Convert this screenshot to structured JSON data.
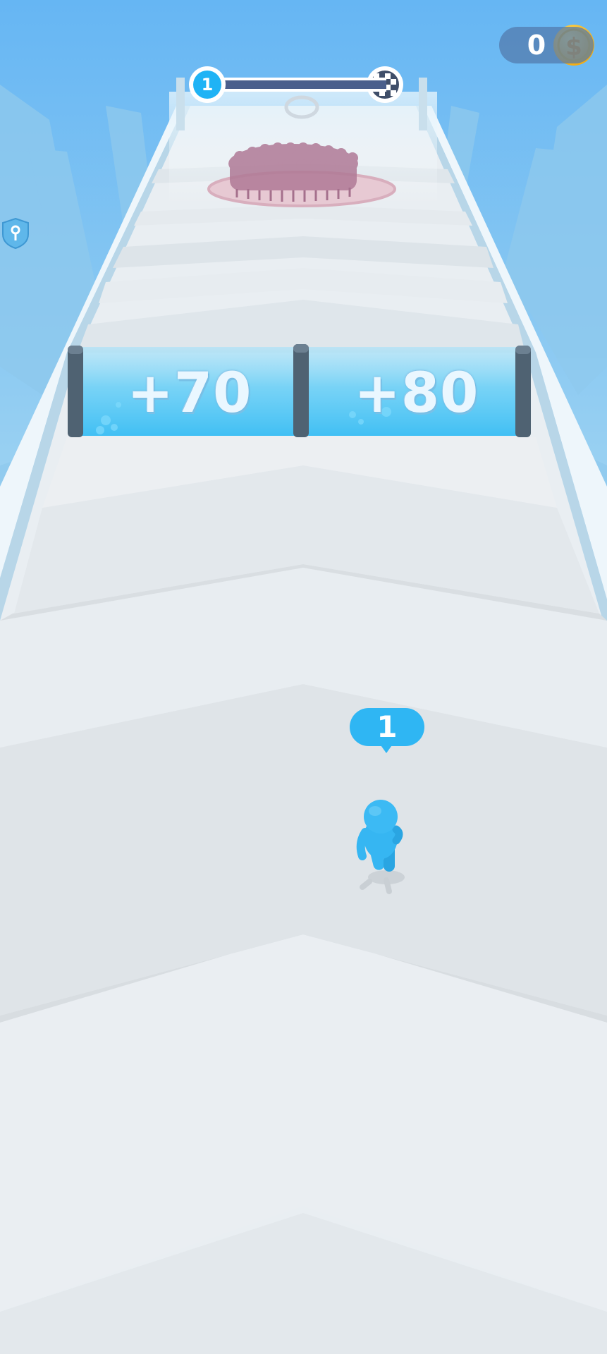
{
  "hud": {
    "coins": "0",
    "coin_icon": "gold-dollar-coin-icon",
    "level_current": "1",
    "level_end_icon": "checkered-flag-icon",
    "level_progress": 0
  },
  "gates": [
    {
      "label": "+70"
    },
    {
      "label": "+80"
    }
  ],
  "player": {
    "count": "1"
  },
  "side_icon": "shield-key-icon",
  "colors": {
    "sky": "#7fc3ef",
    "player": "#36b6f2",
    "gate_glass": "#5fd0f8",
    "enemy_crowd": "#b07a96",
    "coin": "#f7c21a"
  }
}
